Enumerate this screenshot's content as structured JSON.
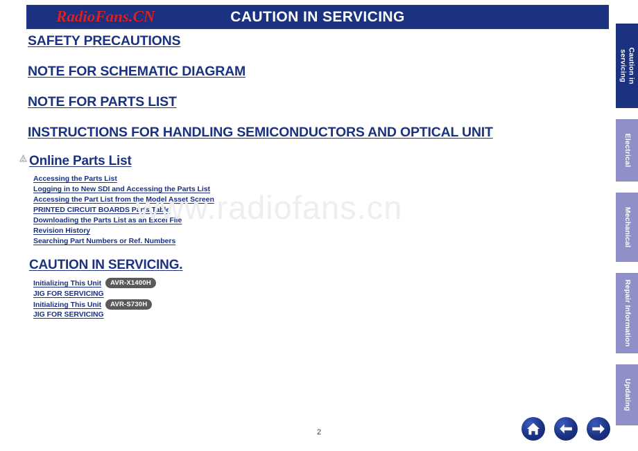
{
  "document": {
    "page_number": "2",
    "watermark_main": "www.radiofans.cn",
    "watermark_banner": "RadioFans.CN",
    "accent_navy": "#1b3281",
    "accent_purple": "#9090c8",
    "accent_red": "#dd1f26",
    "pill_gray": "#5a5a5a"
  },
  "header": {
    "title": "CAUTION IN SERVICING"
  },
  "main_links": [
    {
      "label": "SAFETY PRECAUTIONS"
    },
    {
      "label": "NOTE FOR SCHEMATIC DIAGRAM"
    },
    {
      "label": "NOTE FOR PARTS LIST"
    },
    {
      "label": "INSTRUCTIONS FOR HANDLING SEMICONDUCTORS AND OPTICAL UNIT"
    }
  ],
  "sections": [
    {
      "heading": "Online Parts List",
      "items": [
        {
          "label": "Accessing the Parts List"
        },
        {
          "label": "Logging in to New SDI and Accessing the Parts List"
        },
        {
          "label": "Accessing the Part List from the Model Asset Screen"
        },
        {
          "label": "PRINTED CIRCUIT BOARDS Parts Table"
        },
        {
          "label": "Downloading the Parts List as an Excel File"
        },
        {
          "label": "Revision History"
        },
        {
          "label": "Searching Part Numbers or Ref. Numbers"
        }
      ]
    },
    {
      "heading": "CAUTION IN SERVICING.",
      "items": [
        {
          "label": "Initializing This Unit",
          "badge": "AVR-X1400H"
        },
        {
          "label": "JIG FOR SERVICING",
          "badge": ""
        },
        {
          "label": "Initializing This Unit",
          "badge": "AVR-S730H"
        },
        {
          "label": "JIG FOR SERVICING",
          "badge": ""
        }
      ]
    }
  ],
  "side_tabs": [
    {
      "label_line1": "Caution in",
      "label_line2": "servicing",
      "active": true
    },
    {
      "label_line1": "Electrical",
      "label_line2": "",
      "active": false
    },
    {
      "label_line1": "Mechanical",
      "label_line2": "",
      "active": false
    },
    {
      "label_line1": "Repair Information",
      "label_line2": "",
      "active": false
    },
    {
      "label_line1": "Updating",
      "label_line2": "",
      "active": false
    }
  ],
  "nav_buttons": [
    {
      "name": "home",
      "title": "Home"
    },
    {
      "name": "previous",
      "title": "Previous page"
    },
    {
      "name": "next",
      "title": "Next page"
    }
  ]
}
